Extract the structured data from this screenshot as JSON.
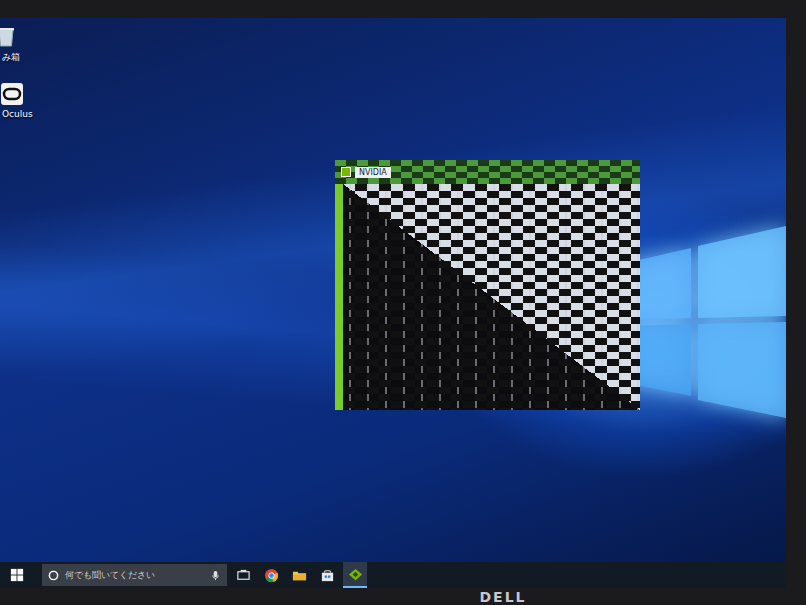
{
  "desktop_icons": [
    {
      "label": "み箱",
      "kind": "recycle-bin"
    },
    {
      "label": "Oculus",
      "kind": "oculus"
    }
  ],
  "window": {
    "title": "NVIDIA"
  },
  "taskbar": {
    "search": {
      "placeholder": "何でも聞いてください"
    },
    "apps": [
      {
        "kind": "task-view",
        "active": false
      },
      {
        "kind": "chrome",
        "active": false
      },
      {
        "kind": "explorer",
        "active": false
      },
      {
        "kind": "store",
        "active": false
      },
      {
        "kind": "app",
        "active": true
      }
    ]
  },
  "monitor": {
    "brand": "DELL"
  }
}
